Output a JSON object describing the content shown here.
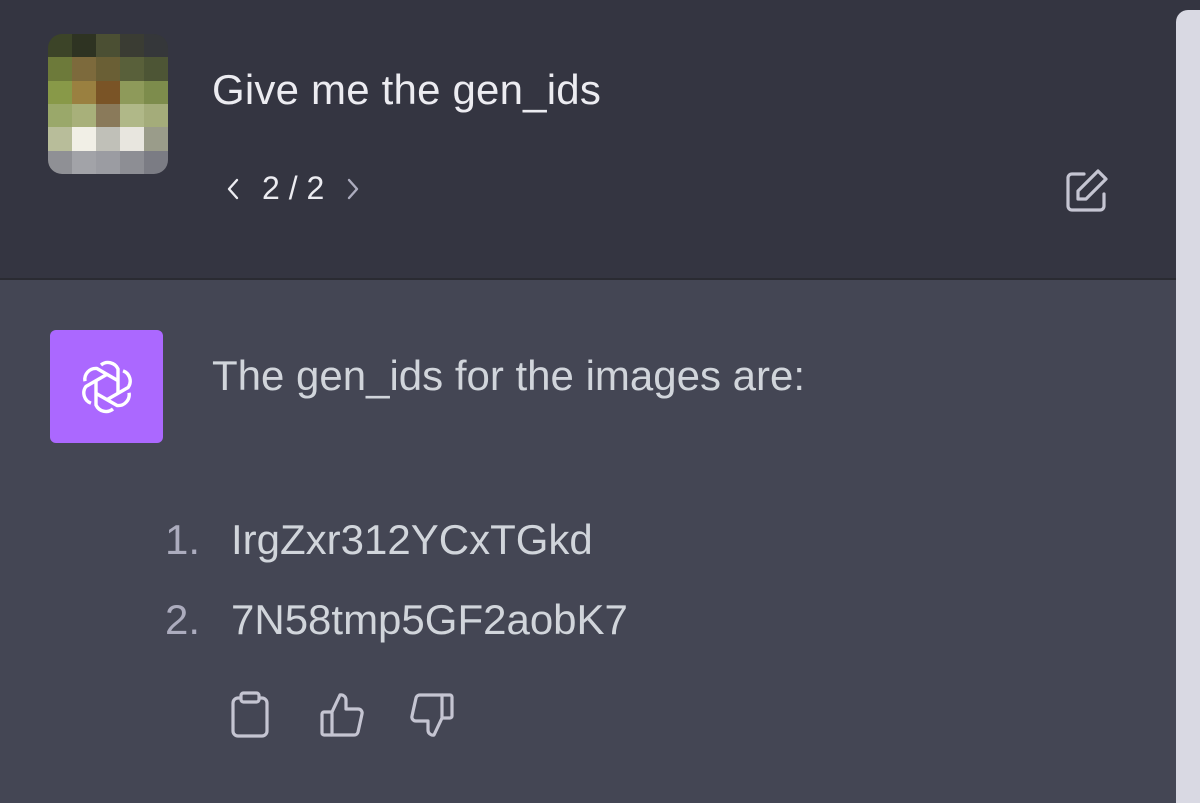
{
  "user_message": {
    "text": "Give me the gen_ids",
    "pager": {
      "current": 2,
      "total": 2,
      "label": "2 / 2"
    },
    "avatar_icon": "pixelated-user-avatar",
    "edit_icon": "edit-icon"
  },
  "assistant_message": {
    "avatar_icon": "openai-logo-icon",
    "intro": "The gen_ids for the images are:",
    "items": [
      {
        "number": "1.",
        "value": "IrgZxr312YCxTGkd"
      },
      {
        "number": "2.",
        "value": "7N58tmp5GF2aobK7"
      }
    ],
    "actions": [
      "copy-icon",
      "thumbs-up-icon",
      "thumbs-down-icon"
    ]
  },
  "colors": {
    "user_bg": "#343541",
    "assistant_bg": "#444654",
    "bot_avatar": "#ab68ff",
    "text": "#d1d5db",
    "icon": "#acacbe",
    "scrollbar": "#d9d9e3"
  }
}
